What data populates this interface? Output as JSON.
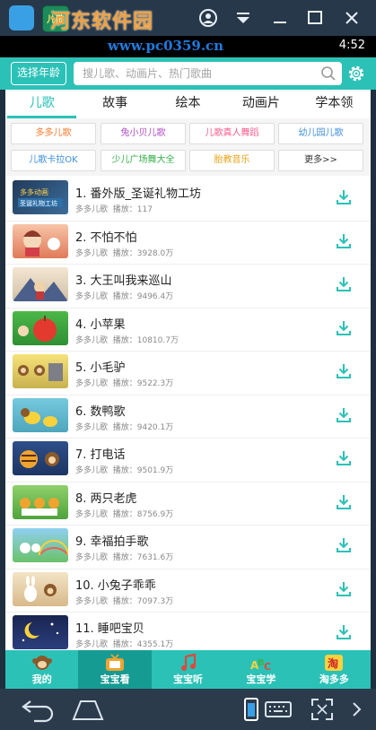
{
  "emulator": {
    "brand_watermark": "河东软件园",
    "app_icon_text": "儿歌"
  },
  "statusbar": {
    "url_watermark": "www.pc0359.cn",
    "time": "4:52"
  },
  "header": {
    "age_button": "选择年龄",
    "search_placeholder": "搜儿歌、动画片、热门歌曲"
  },
  "tabs": [
    {
      "label": "儿歌",
      "active": true
    },
    {
      "label": "故事",
      "active": false
    },
    {
      "label": "绘本",
      "active": false
    },
    {
      "label": "动画片",
      "active": false
    },
    {
      "label": "学本领",
      "active": false
    }
  ],
  "tags": [
    {
      "label": "多多儿歌",
      "color": "#ff7a2e"
    },
    {
      "label": "兔小贝儿歌",
      "color": "#b24fc7"
    },
    {
      "label": "儿歌真人舞蹈",
      "color": "#ff5a8a"
    },
    {
      "label": "幼儿园儿歌",
      "color": "#3f8fe0"
    },
    {
      "label": "儿歌卡拉OK",
      "color": "#3a8fe0"
    },
    {
      "label": "少儿广场舞大全",
      "color": "#34b04a"
    },
    {
      "label": "胎教音乐",
      "color": "#e8a316"
    },
    {
      "label": "更多>>",
      "color": "#333333"
    }
  ],
  "songs": [
    {
      "title": "1. 番外版_圣诞礼物工坊",
      "source": "多多儿歌",
      "plays": "播放：117"
    },
    {
      "title": "2. 不怕不怕",
      "source": "多多儿歌",
      "plays": "播放：3928.0万"
    },
    {
      "title": "3. 大王叫我来巡山",
      "source": "多多儿歌",
      "plays": "播放：9496.4万"
    },
    {
      "title": "4. 小苹果",
      "source": "多多儿歌",
      "plays": "播放：10810.7万"
    },
    {
      "title": "5. 小毛驴",
      "source": "多多儿歌",
      "plays": "播放：9522.3万"
    },
    {
      "title": "6. 数鸭歌",
      "source": "多多儿歌",
      "plays": "播放：9420.1万"
    },
    {
      "title": "7. 打电话",
      "source": "多多儿歌",
      "plays": "播放：9501.9万"
    },
    {
      "title": "8. 两只老虎",
      "source": "多多儿歌",
      "plays": "播放：8756.9万"
    },
    {
      "title": "9. 幸福拍手歌",
      "source": "多多儿歌",
      "plays": "播放：7631.6万"
    },
    {
      "title": "10. 小兔子乖乖",
      "source": "多多儿歌",
      "plays": "播放：7097.3万"
    },
    {
      "title": "11. 睡吧宝贝",
      "source": "多多儿歌",
      "plays": "播放：4355.1万"
    }
  ],
  "bottom_nav": [
    {
      "label": "我的",
      "icon": "monkey-icon",
      "active": false
    },
    {
      "label": "宝宝看",
      "icon": "tv-icon",
      "active": true
    },
    {
      "label": "宝宝听",
      "icon": "music-note-icon",
      "active": false
    },
    {
      "label": "宝宝学",
      "icon": "abc-icon",
      "active": false
    },
    {
      "label": "淘多多",
      "icon": "tao-icon",
      "active": false
    }
  ],
  "colors": {
    "accent": "#2bc1b7",
    "download": "#2bc1b7"
  }
}
